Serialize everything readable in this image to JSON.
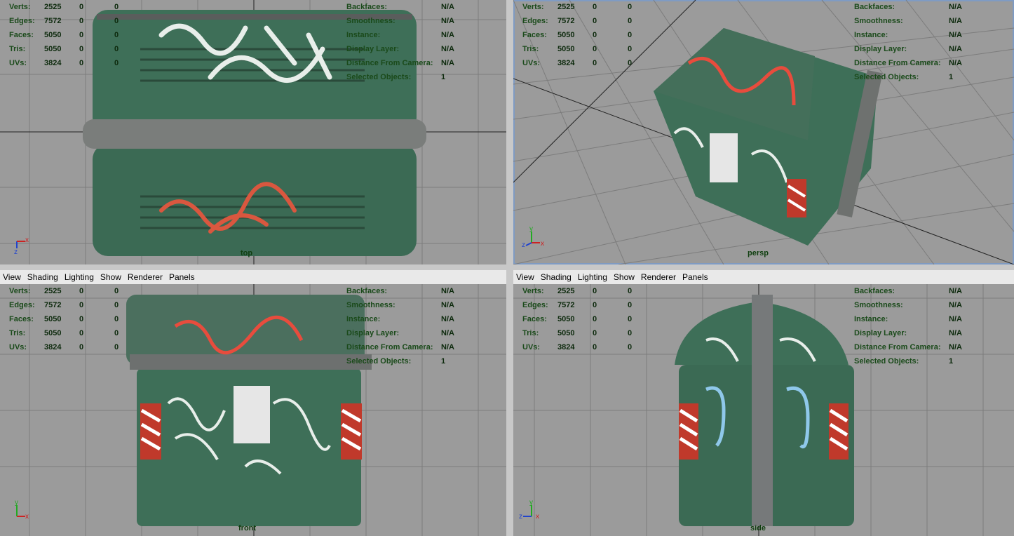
{
  "menus": [
    "View",
    "Shading",
    "Lighting",
    "Show",
    "Renderer",
    "Panels"
  ],
  "stats": {
    "rows": [
      {
        "label": "Verts:",
        "v1": "2525",
        "v2": "0",
        "v3": "0"
      },
      {
        "label": "Edges:",
        "v1": "7572",
        "v2": "0",
        "v3": "0"
      },
      {
        "label": "Faces:",
        "v1": "5050",
        "v2": "0",
        "v3": "0"
      },
      {
        "label": "Tris:",
        "v1": "5050",
        "v2": "0",
        "v3": "0"
      },
      {
        "label": "UVs:",
        "v1": "3824",
        "v2": "0",
        "v3": "0"
      }
    ],
    "right_rows": [
      {
        "label": "Backfaces:",
        "value": "N/A"
      },
      {
        "label": "Smoothness:",
        "value": "N/A"
      },
      {
        "label": "Instance:",
        "value": "N/A"
      },
      {
        "label": "Display Layer:",
        "value": "N/A"
      },
      {
        "label": "Distance From Camera:",
        "value": "N/A"
      },
      {
        "label": "Selected Objects:",
        "value": "1"
      }
    ]
  },
  "viewports": {
    "top": {
      "camera": "top"
    },
    "persp": {
      "camera": "persp"
    },
    "front": {
      "camera": "front"
    },
    "side": {
      "camera": "side"
    }
  },
  "colors": {
    "viewport_bg": "#9b9b9b",
    "hud_text": "#1a4a1a",
    "bin_green": "#3e6f58",
    "accent_border": "#7f9bc3"
  }
}
